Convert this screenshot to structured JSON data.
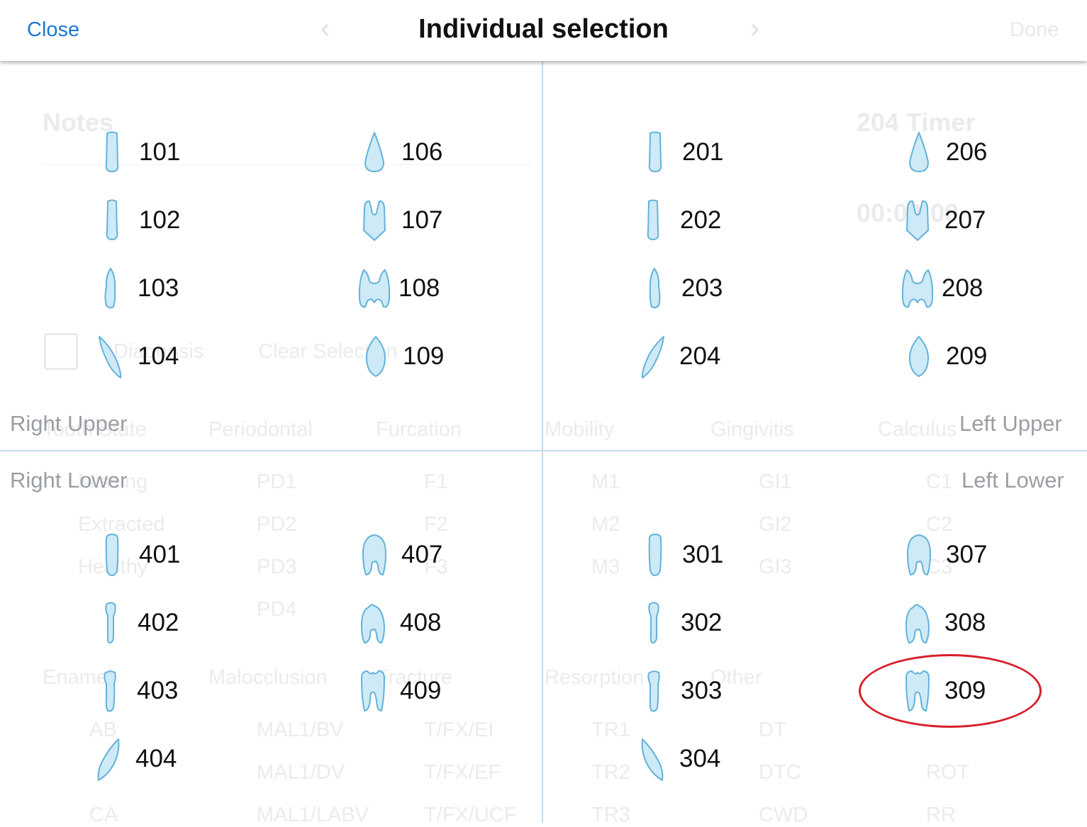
{
  "header": {
    "close_label": "Close",
    "title": "Individual selection"
  },
  "quadrants": {
    "right_upper": "Right Upper",
    "left_upper": "Left Upper",
    "right_lower": "Right Lower",
    "left_lower": "Left Lower"
  },
  "teeth": {
    "t101": "101",
    "t102": "102",
    "t103": "103",
    "t104": "104",
    "t106": "106",
    "t107": "107",
    "t108": "108",
    "t109": "109",
    "t201": "201",
    "t202": "202",
    "t203": "203",
    "t204": "204",
    "t206": "206",
    "t207": "207",
    "t208": "208",
    "t209": "209",
    "t401": "401",
    "t402": "402",
    "t403": "403",
    "t404": "404",
    "t407": "407",
    "t408": "408",
    "t409": "409",
    "t301": "301",
    "t302": "302",
    "t303": "303",
    "t304": "304",
    "t307": "307",
    "t308": "308",
    "t309": "309"
  },
  "highlighted_tooth": "309",
  "colors": {
    "accent": "#1a78d0",
    "tooth_fill": "#cdeaf6",
    "tooth_stroke": "#64b2da",
    "divider": "#c5dbeb",
    "highlight": "#d8202a"
  }
}
